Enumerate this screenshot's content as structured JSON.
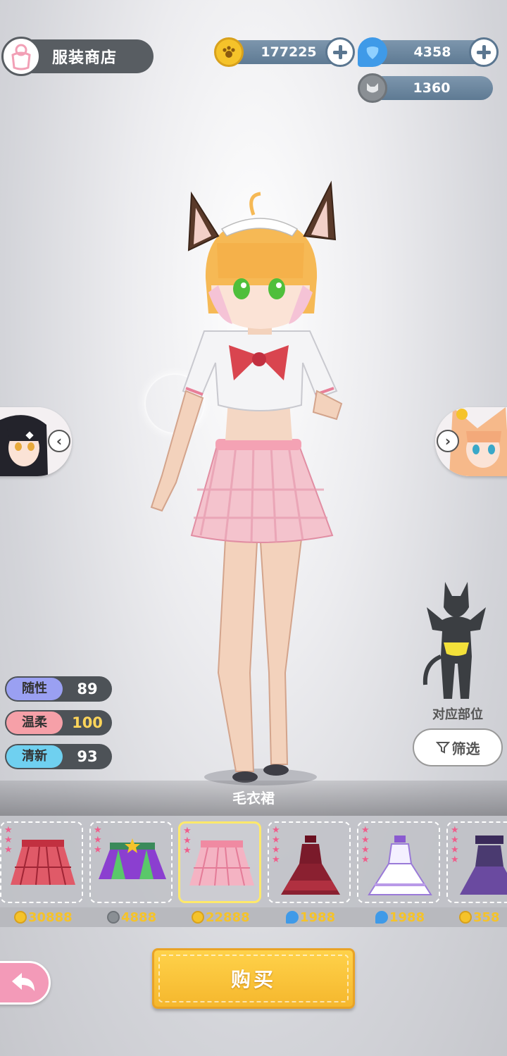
{
  "header": {
    "title": "服装商店",
    "icon": "outfit-icon"
  },
  "currency": {
    "coins": "177225",
    "gems": "4358",
    "tokens": "1360",
    "colors": {
      "coin": "#f5c32a",
      "gem": "#3f9ae8",
      "token": "#8a8f94"
    }
  },
  "stats": [
    {
      "label": "随性",
      "value": "89",
      "color": "#9aa0f2",
      "value_color": "#ffffff"
    },
    {
      "label": "温柔",
      "value": "100",
      "color": "#f6a0a8",
      "value_color": "#ffd55a"
    },
    {
      "label": "清新",
      "value": "93",
      "color": "#6fd0f0",
      "value_color": "#ffffff"
    }
  ],
  "part": {
    "label": "对应部位",
    "filter_label": "筛选"
  },
  "current_item": "毛衣裙",
  "items": [
    {
      "price": "30888",
      "currency": "coin",
      "stars": 3
    },
    {
      "price": "4888",
      "currency": "token",
      "stars": 3
    },
    {
      "price": "22888",
      "currency": "coin",
      "stars": 3,
      "selected": true
    },
    {
      "price": "1988",
      "currency": "gem",
      "stars": 4
    },
    {
      "price": "1988",
      "currency": "gem",
      "stars": 4
    },
    {
      "price": "358",
      "currency": "coin",
      "stars": 4
    }
  ],
  "buy_label": "购买"
}
